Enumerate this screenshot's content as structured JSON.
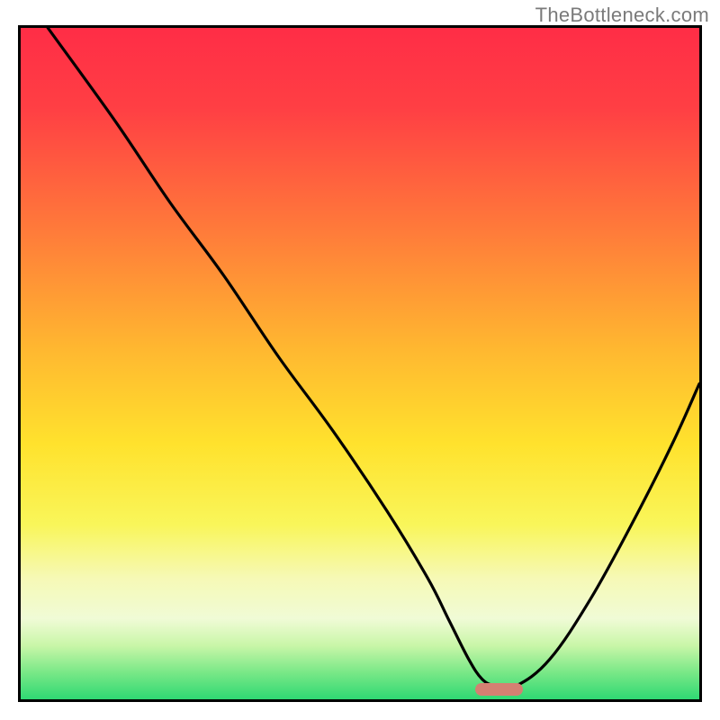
{
  "attribution": "TheBottleneck.com",
  "chart_data": {
    "type": "line",
    "title": "",
    "xlabel": "",
    "ylabel": "",
    "xlim": [
      0,
      100
    ],
    "ylim": [
      0,
      100
    ],
    "grid": false,
    "legend": false,
    "series": [
      {
        "name": "bottleneck-curve",
        "x": [
          4,
          14,
          22,
          30,
          38,
          46,
          54,
          60,
          63,
          66,
          68,
          70,
          73,
          78,
          84,
          90,
          96,
          100
        ],
        "values": [
          100,
          86,
          74,
          63,
          51,
          40,
          28,
          18,
          12,
          6,
          3,
          2,
          2,
          6,
          15,
          26,
          38,
          47
        ]
      }
    ],
    "optimal_marker": {
      "x_start": 67,
      "x_end": 74,
      "y_center": 1.5
    },
    "background": {
      "gradient_stops": [
        {
          "pos": 0,
          "color": "#ff2d46"
        },
        {
          "pos": 12,
          "color": "#ff3f44"
        },
        {
          "pos": 30,
          "color": "#ff7a3a"
        },
        {
          "pos": 48,
          "color": "#ffb830"
        },
        {
          "pos": 62,
          "color": "#ffe22d"
        },
        {
          "pos": 74,
          "color": "#f9f65a"
        },
        {
          "pos": 82,
          "color": "#f6f9b6"
        },
        {
          "pos": 88,
          "color": "#f0fbd6"
        },
        {
          "pos": 92,
          "color": "#c9f6a8"
        },
        {
          "pos": 96,
          "color": "#79e887"
        },
        {
          "pos": 100,
          "color": "#2fd873"
        }
      ]
    }
  }
}
